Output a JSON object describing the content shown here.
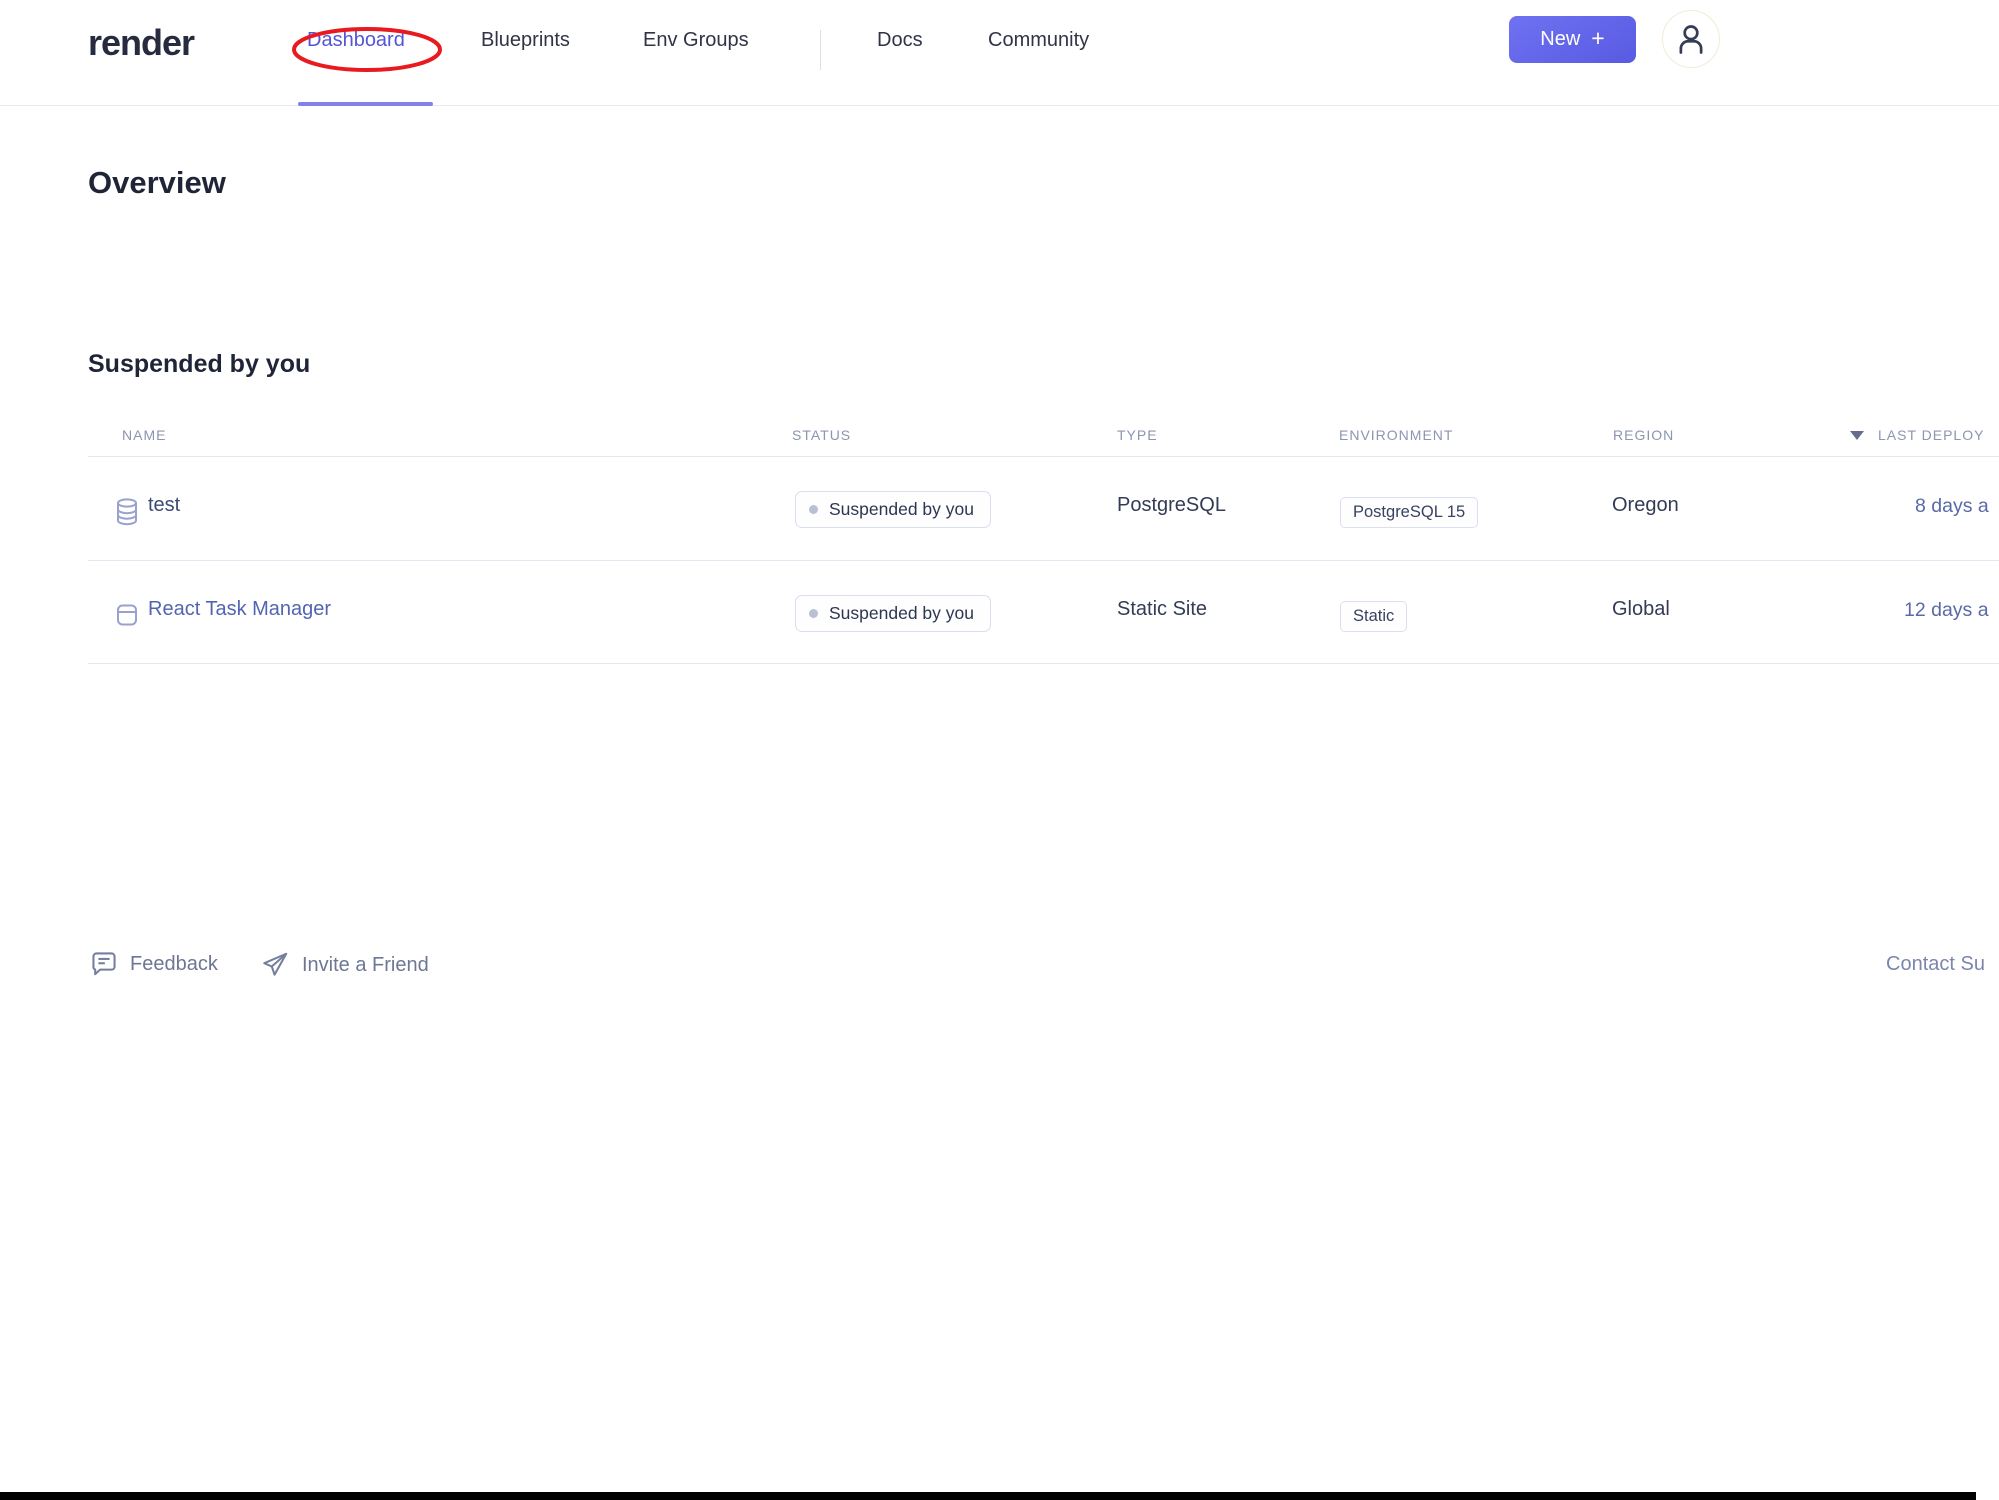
{
  "brand": {
    "logo_text": "render"
  },
  "nav": {
    "items": [
      {
        "label": "Dashboard",
        "active": true,
        "annotated_with_red_circle": true
      },
      {
        "label": "Blueprints",
        "active": false
      },
      {
        "label": "Env Groups",
        "active": false
      },
      {
        "label": "Docs",
        "active": false
      },
      {
        "label": "Community",
        "active": false
      }
    ],
    "new_button_label": "New",
    "new_button_plus": "+"
  },
  "page": {
    "title": "Overview",
    "section_title": "Suspended by you"
  },
  "table": {
    "columns": [
      "NAME",
      "STATUS",
      "TYPE",
      "ENVIRONMENT",
      "REGION",
      "LAST DEPLOY"
    ],
    "sorted_column": "LAST DEPLOY",
    "sort_direction": "desc",
    "rows": [
      {
        "icon": "database-icon",
        "name": "test",
        "status": "Suspended by you",
        "type": "PostgreSQL",
        "environment": "PostgreSQL 15",
        "region": "Oregon",
        "last_deploy": "8 days a"
      },
      {
        "icon": "static-site-icon",
        "name": "React Task Manager",
        "status": "Suspended by you",
        "type": "Static Site",
        "environment": "Static",
        "region": "Global",
        "last_deploy": "12 days a"
      }
    ]
  },
  "footer": {
    "feedback_label": "Feedback",
    "invite_label": "Invite a Friend",
    "contact_label": "Contact Su"
  },
  "colors": {
    "nav_active": "#5355d8",
    "active_underline": "#8082e9",
    "annotation_red": "#e8191f",
    "new_button_gradient_start": "#6f72f1",
    "new_button_gradient_end": "#585ae2",
    "heading_text": "#1f2437",
    "column_header_text": "#8c95b1",
    "table_line": "#e4e8f3",
    "badge_border": "#d9dfef",
    "status_dot": "#b9c0d4",
    "row_icon_lavender": "#99a1cf",
    "deploy_link": "#5a69a8",
    "footer_link": "#6d7795",
    "bottom_bar": "#010101"
  }
}
